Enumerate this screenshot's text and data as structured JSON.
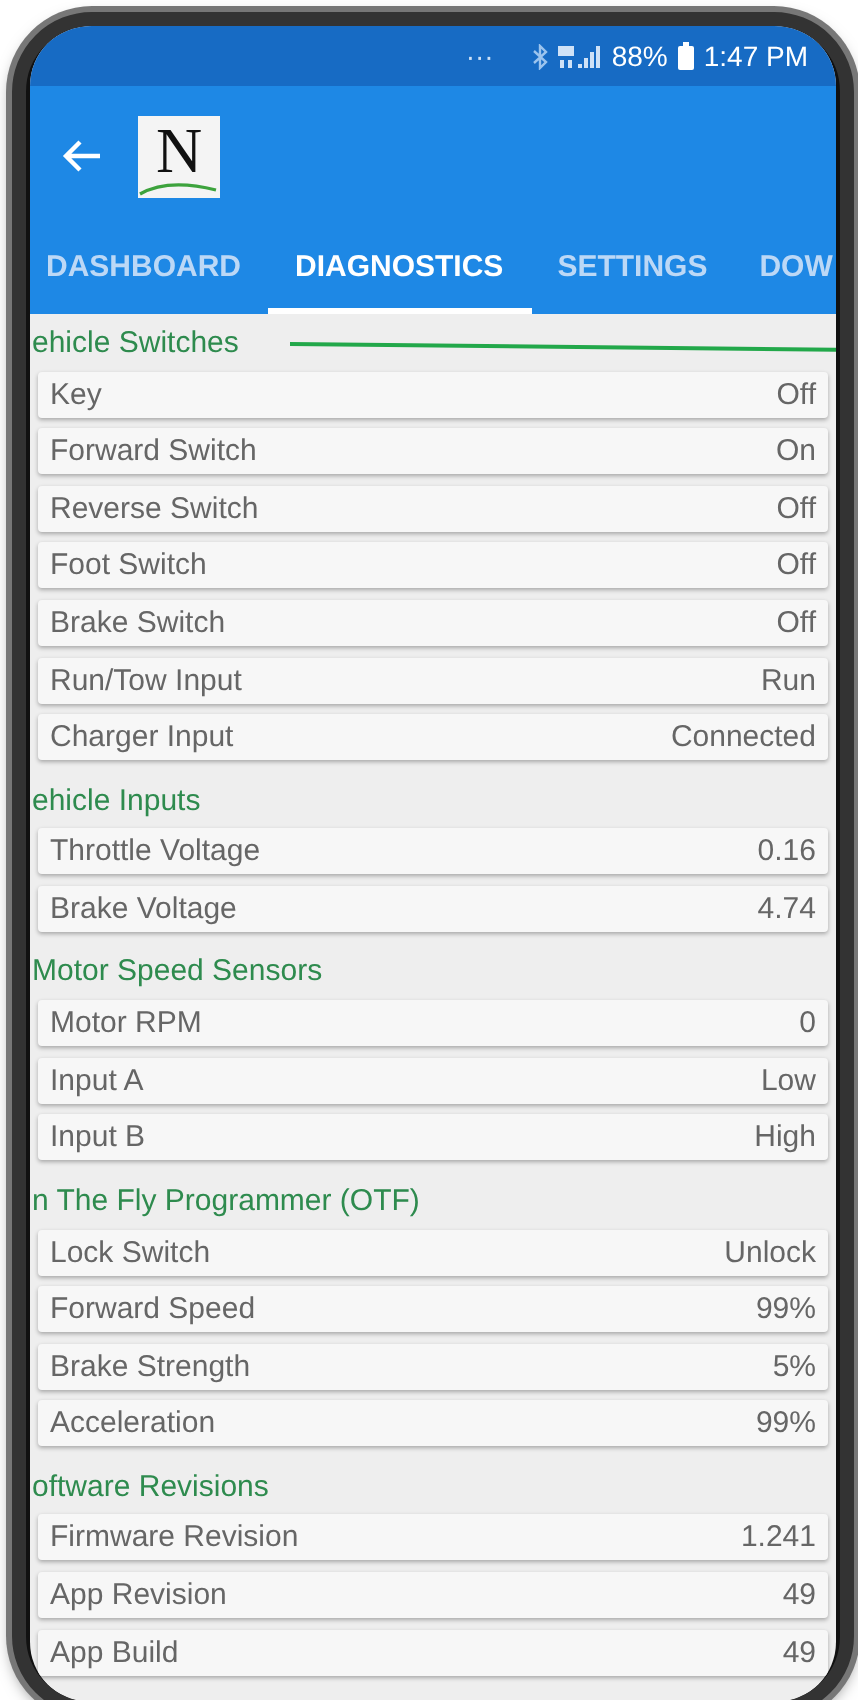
{
  "status_bar": {
    "dots": "···",
    "battery": "88%",
    "time": "1:47 PM"
  },
  "app_bar": {
    "logo": "N"
  },
  "tabs": [
    {
      "label": "DASHBOARD",
      "selected": false
    },
    {
      "label": "DIAGNOSTICS",
      "selected": true
    },
    {
      "label": "SETTINGS",
      "selected": false
    },
    {
      "label": "DOW",
      "selected": false
    }
  ],
  "sections": [
    {
      "title": "ehicle Switches",
      "rows": [
        {
          "label": "Key",
          "value": "Off"
        },
        {
          "label": "Forward Switch",
          "value": "On"
        },
        {
          "label": "Reverse Switch",
          "value": "Off"
        },
        {
          "label": "Foot Switch",
          "value": "Off"
        },
        {
          "label": "Brake Switch",
          "value": "Off"
        },
        {
          "label": "Run/Tow Input",
          "value": "Run"
        },
        {
          "label": "Charger Input",
          "value": "Connected"
        }
      ]
    },
    {
      "title": "ehicle Inputs",
      "rows": [
        {
          "label": "Throttle Voltage",
          "value": "0.16"
        },
        {
          "label": "Brake Voltage",
          "value": "4.74"
        }
      ]
    },
    {
      "title": "Motor Speed Sensors",
      "rows": [
        {
          "label": "Motor RPM",
          "value": "0"
        },
        {
          "label": "Input A",
          "value": "Low"
        },
        {
          "label": "Input B",
          "value": "High"
        }
      ]
    },
    {
      "title": "n The Fly Programmer (OTF)",
      "rows": [
        {
          "label": "Lock Switch",
          "value": "Unlock"
        },
        {
          "label": "Forward Speed",
          "value": "99%"
        },
        {
          "label": "Brake Strength",
          "value": "5%"
        },
        {
          "label": "Acceleration",
          "value": "99%"
        }
      ]
    },
    {
      "title": "oftware Revisions",
      "rows": [
        {
          "label": "Firmware Revision",
          "value": "1.241"
        },
        {
          "label": "App Revision",
          "value": "49"
        },
        {
          "label": "App Build",
          "value": "49"
        }
      ]
    }
  ]
}
